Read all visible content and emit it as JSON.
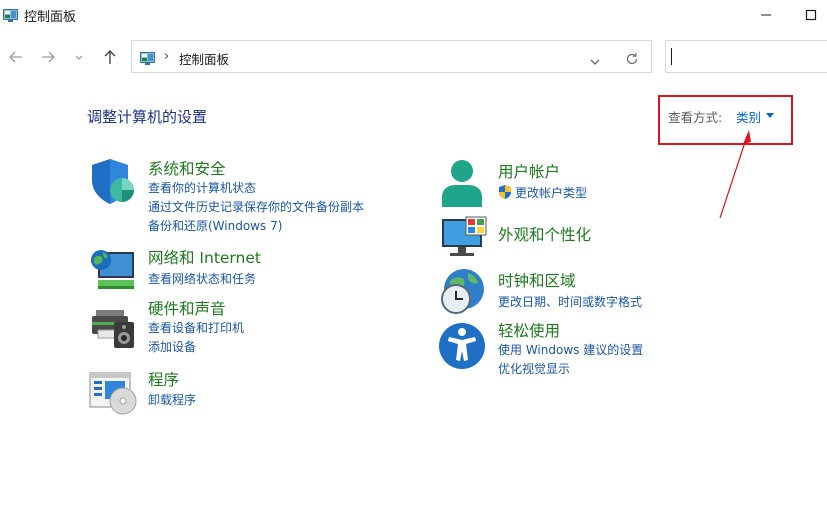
{
  "window": {
    "title": "控制面板"
  },
  "address": {
    "path": "控制面板",
    "separator": "›"
  },
  "search": {
    "value": ""
  },
  "page_title": "调整计算机的设置",
  "view": {
    "label": "查看方式:",
    "value": "类别"
  },
  "colors": {
    "category_title": "#1e7a1e",
    "link": "#1a56a6",
    "heading": "#1e3287",
    "annotation": "#e0141e"
  },
  "categories": {
    "security": {
      "icon": "shield-icon",
      "title": "系统和安全",
      "links": [
        "查看你的计算机状态",
        "通过文件历史记录保存你的文件备份副本",
        "备份和还原(Windows 7)"
      ]
    },
    "network": {
      "icon": "globe-monitor-icon",
      "title": "网络和 Internet",
      "links": [
        "查看网络状态和任务"
      ]
    },
    "hardware": {
      "icon": "printer-speaker-icon",
      "title": "硬件和声音",
      "links": [
        "查看设备和打印机",
        "添加设备"
      ]
    },
    "programs": {
      "icon": "programs-disc-icon",
      "title": "程序",
      "links": [
        "卸载程序"
      ]
    },
    "accounts": {
      "icon": "user-icon",
      "title": "用户帐户",
      "links": [
        "更改帐户类型"
      ]
    },
    "appearance": {
      "icon": "monitor-palette-icon",
      "title": "外观和个性化",
      "links": []
    },
    "clock": {
      "icon": "clock-globe-icon",
      "title": "时钟和区域",
      "links": [
        "更改日期、时间或数字格式"
      ]
    },
    "ease": {
      "icon": "accessibility-icon",
      "title": "轻松使用",
      "links": [
        "使用 Windows 建议的设置",
        "优化视觉显示"
      ]
    }
  }
}
